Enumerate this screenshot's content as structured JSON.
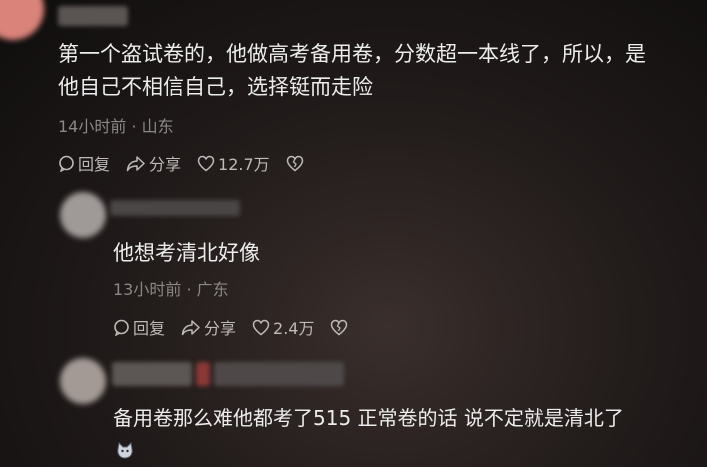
{
  "comments": [
    {
      "text_line1": "第一个盗试卷的，他做高考备用卷，分数超一本线了，所以，是",
      "text_line2": "他自己不相信自己，选择铤而走险",
      "time": "14小时前",
      "sep": "·",
      "location": "山东",
      "reply_label": "回复",
      "share_label": "分享",
      "like_count": "12.7万"
    },
    {
      "text": "他想考清北好像",
      "time": "13小时前",
      "sep": "·",
      "location": "广东",
      "reply_label": "回复",
      "share_label": "分享",
      "like_count": "2.4万"
    },
    {
      "text": "备用卷那么难他都考了515 正常卷的话 说不定就是清北了",
      "sticker_icon": "cat-sticker-icon"
    }
  ],
  "colors": {
    "text": "#ececec",
    "meta": "#8a8785",
    "action": "#bdbab8"
  }
}
